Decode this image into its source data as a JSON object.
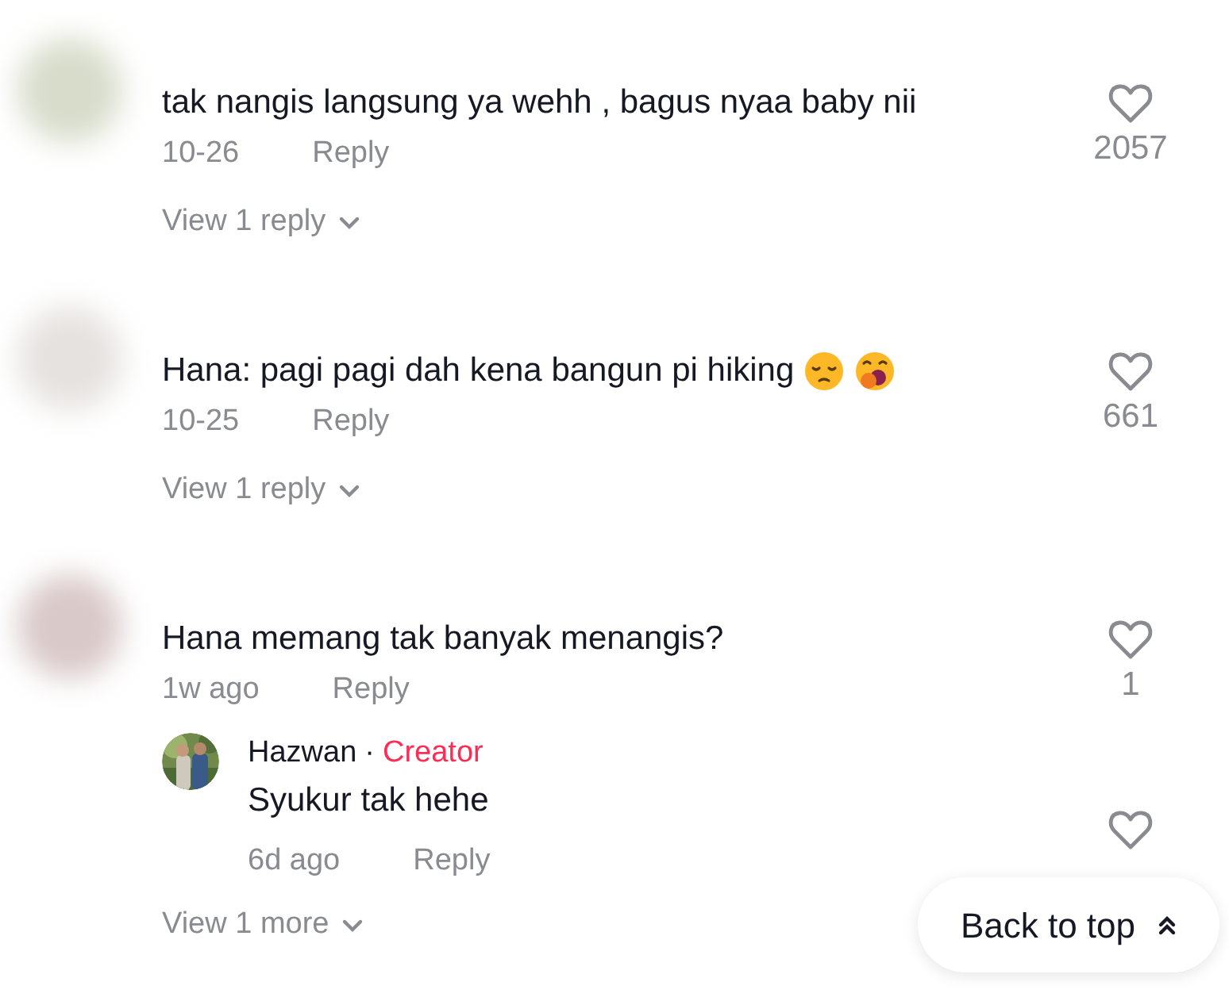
{
  "comments": [
    {
      "text": "tak nangis langsung ya wehh , bagus nyaa baby nii",
      "date": "10-26",
      "reply_label": "Reply",
      "likes": "2057",
      "view_replies": "View 1 reply"
    },
    {
      "text": "Hana: pagi pagi dah kena bangun pi hiking",
      "emojis": [
        {
          "kind": "pensive"
        },
        {
          "kind": "yawning"
        }
      ],
      "date": "10-25",
      "reply_label": "Reply",
      "likes": "661",
      "view_replies": "View 1 reply"
    },
    {
      "text": "Hana memang tak banyak menangis?",
      "date": "1w ago",
      "reply_label": "Reply",
      "likes": "1",
      "view_replies": "View 1 more",
      "replies": [
        {
          "author": "Hazwan",
          "separator": "·",
          "badge": "Creator",
          "text": "Syukur tak hehe",
          "date": "6d ago",
          "reply_label": "Reply"
        }
      ]
    }
  ],
  "back_to_top": {
    "label": "Back to top"
  }
}
